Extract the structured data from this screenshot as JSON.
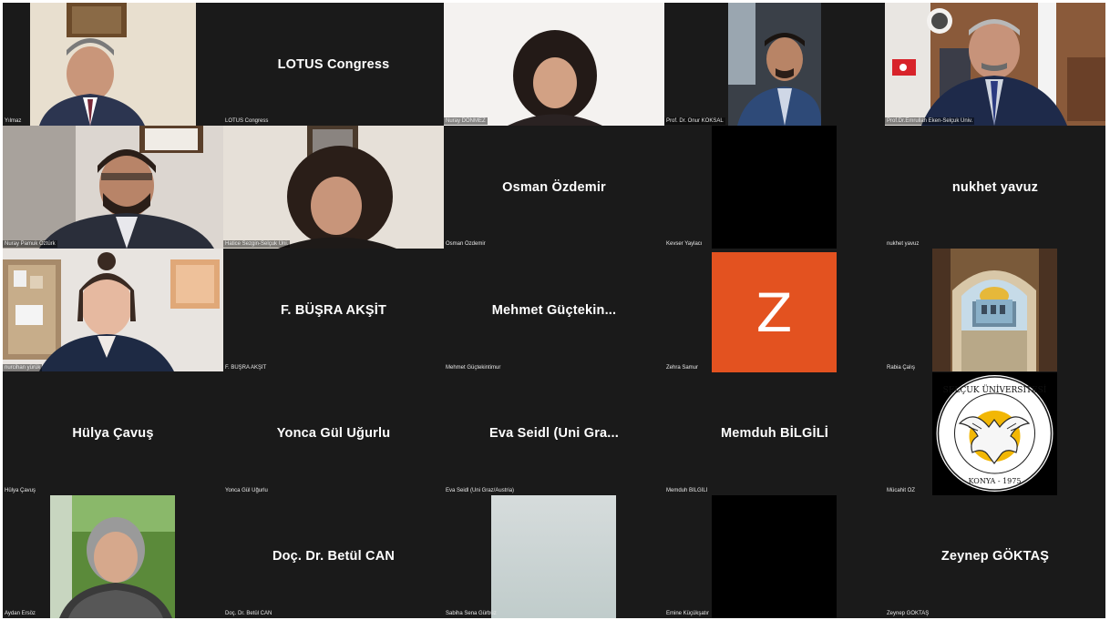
{
  "meeting": {
    "tiles": [
      {
        "label": "Yılmaz",
        "center": ""
      },
      {
        "label": "LOTUS Congress",
        "center": "LOTUS Congress"
      },
      {
        "label": "Nuray DÖNMEZ",
        "center": ""
      },
      {
        "label": "Prof. Dr. Onur KÖKSAL",
        "center": ""
      },
      {
        "label": "Prof.Dr.Emrullah Eken-Selçuk Üniv.",
        "center": ""
      },
      {
        "label": "Nuray Pamuk Öztürk",
        "center": ""
      },
      {
        "label": "Hatice Sezgin-Selçuk Üni.",
        "center": ""
      },
      {
        "label": "Osman Özdemir",
        "center": "Osman Özdemir"
      },
      {
        "label": "Kevser Yaylacı",
        "center": ""
      },
      {
        "label": "nukhet yavuz",
        "center": "nukhet yavuz"
      },
      {
        "label": "nurcihan yürük",
        "center": ""
      },
      {
        "label": "F. BÜŞRA AKŞİT",
        "center": "F. BÜŞRA AKŞİT"
      },
      {
        "label": "Mehmet Güçtekintimur",
        "center": "Mehmet  Güçtekin..."
      },
      {
        "label": "Zehra Samur",
        "center": ""
      },
      {
        "label": "Rabia Çalış",
        "center": ""
      },
      {
        "label": "Hülya Çavuş",
        "center": "Hülya Çavuş"
      },
      {
        "label": "Yonca Gül Uğurlu",
        "center": "Yonca Gül Uğurlu"
      },
      {
        "label": "Eva Seidl (Uni Graz/Austria)",
        "center": "Eva Seidl (Uni Gra..."
      },
      {
        "label": "Memduh BİLGİLİ",
        "center": "Memduh BİLGİLİ"
      },
      {
        "label": "Mücahit ÖZ",
        "center": ""
      },
      {
        "label": "Aydan Ersöz",
        "center": ""
      },
      {
        "label": "Doç. Dr. Betül CAN",
        "center": "Doç. Dr. Betül CAN"
      },
      {
        "label": "Sabiha Sena Gürbüz",
        "center": ""
      },
      {
        "label": "Emine Küçükşatır",
        "center": ""
      },
      {
        "label": "Zeynep GÖKTAŞ",
        "center": "Zeynep GÖKTAŞ"
      }
    ],
    "avatar_letter": "Z",
    "logo": {
      "text_top": "SELÇUK ÜNİVERSİTESİ",
      "text_bottom": "KONYA - 1975"
    }
  },
  "colors": {
    "tile_bg": "#1a1a1a",
    "avatar_orange": "#e35220",
    "logo_gold": "#f2b705"
  }
}
